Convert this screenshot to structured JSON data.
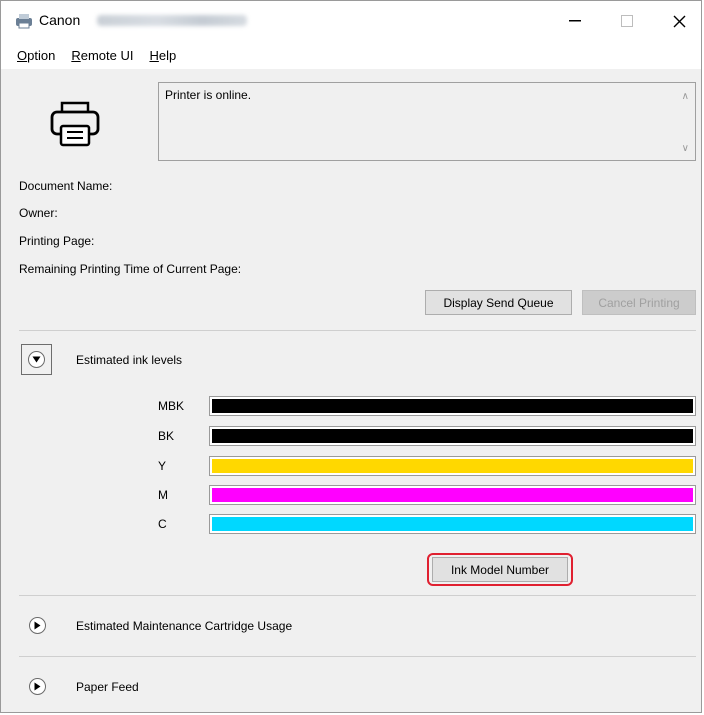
{
  "window": {
    "title": "Canon"
  },
  "menu": [
    {
      "label": "Option",
      "underline": "O",
      "rest": "ption"
    },
    {
      "label": "Remote UI",
      "underline": "R",
      "rest": "emote UI"
    },
    {
      "label": "Help",
      "underline": "H",
      "rest": "elp"
    }
  ],
  "status": {
    "message": "Printer is online."
  },
  "fields": {
    "document_name": "Document Name:",
    "owner": "Owner:",
    "printing_page": "Printing Page:",
    "remaining_time": "Remaining Printing Time of Current Page:"
  },
  "buttons": {
    "display_send_queue": "Display Send Queue",
    "cancel_printing": "Cancel Printing",
    "ink_model_number": "Ink Model Number"
  },
  "sections": {
    "ink_levels": "Estimated ink levels",
    "maintenance": "Estimated Maintenance Cartridge Usage",
    "paper_feed": "Paper Feed"
  },
  "inks": [
    {
      "label": "MBK",
      "color": "#000000",
      "level": 1.0
    },
    {
      "label": "BK",
      "color": "#000000",
      "level": 1.0
    },
    {
      "label": "Y",
      "color": "#ffd800",
      "level": 1.0
    },
    {
      "label": "M",
      "color": "#ff00ff",
      "level": 1.0
    },
    {
      "label": "C",
      "color": "#00d8ff",
      "level": 1.0
    }
  ],
  "colors": {
    "highlight": "#e02030"
  }
}
